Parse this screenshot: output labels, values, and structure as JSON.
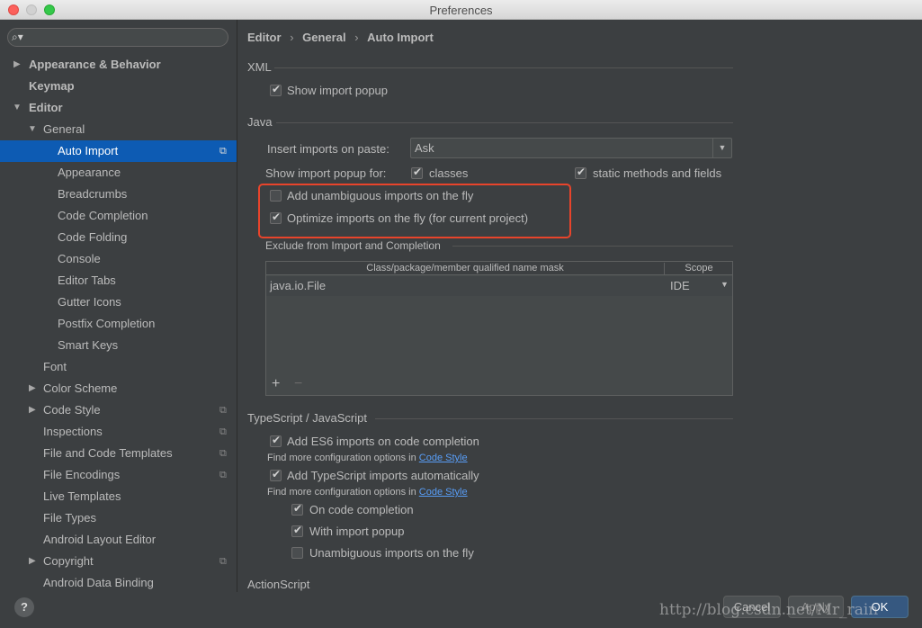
{
  "window": {
    "title": "Preferences"
  },
  "sidebar": {
    "search_placeholder": "",
    "items": [
      {
        "label": "Appearance & Behavior"
      },
      {
        "label": "Keymap"
      },
      {
        "label": "Editor"
      },
      {
        "label": "General"
      },
      {
        "label": "Auto Import"
      },
      {
        "label": "Appearance"
      },
      {
        "label": "Breadcrumbs"
      },
      {
        "label": "Code Completion"
      },
      {
        "label": "Code Folding"
      },
      {
        "label": "Console"
      },
      {
        "label": "Editor Tabs"
      },
      {
        "label": "Gutter Icons"
      },
      {
        "label": "Postfix Completion"
      },
      {
        "label": "Smart Keys"
      },
      {
        "label": "Font"
      },
      {
        "label": "Color Scheme"
      },
      {
        "label": "Code Style"
      },
      {
        "label": "Inspections"
      },
      {
        "label": "File and Code Templates"
      },
      {
        "label": "File Encodings"
      },
      {
        "label": "Live Templates"
      },
      {
        "label": "File Types"
      },
      {
        "label": "Android Layout Editor"
      },
      {
        "label": "Copyright"
      },
      {
        "label": "Android Data Binding"
      }
    ]
  },
  "breadcrumb": {
    "items": [
      "Editor",
      "General",
      "Auto Import"
    ],
    "separator": "›"
  },
  "xml": {
    "section": "XML",
    "show_import_popup": {
      "label": "Show import popup",
      "checked": true
    }
  },
  "java": {
    "section": "Java",
    "insert_imports_label": "Insert imports on paste:",
    "insert_imports_value": "Ask",
    "show_popup_for_label": "Show import popup for:",
    "classes": {
      "label": "classes",
      "checked": true
    },
    "static_methods": {
      "label": "static methods and fields",
      "checked": true
    },
    "add_unambiguous": {
      "label": "Add unambiguous imports on the fly",
      "checked": false
    },
    "optimize_imports": {
      "label": "Optimize imports on the fly (for current project)",
      "checked": true
    },
    "exclude_label": "Exclude from Import and Completion",
    "table": {
      "col_mask": "Class/package/member qualified name mask",
      "col_scope": "Scope",
      "rows": [
        {
          "mask": "java.io.File",
          "scope": "IDE"
        }
      ],
      "add": "+",
      "remove": "−"
    }
  },
  "typescript": {
    "section": "TypeScript / JavaScript",
    "add_es6": {
      "label": "Add ES6 imports on code completion",
      "checked": true
    },
    "find_more_1": "Find more configuration options in",
    "code_style_link_1": "Code Style",
    "add_ts": {
      "label": "Add TypeScript imports automatically",
      "checked": true
    },
    "find_more_2": "Find more configuration options in",
    "code_style_link_2": "Code Style",
    "on_completion": {
      "label": "On code completion",
      "checked": true
    },
    "with_popup": {
      "label": "With import popup",
      "checked": true
    },
    "unambiguous": {
      "label": "Unambiguous imports on the fly",
      "checked": false
    }
  },
  "actionscript": {
    "section": "ActionScript"
  },
  "buttons": {
    "help": "?",
    "cancel": "Cancel",
    "apply": "Apply",
    "ok": "OK"
  },
  "watermark": "http://blog.csdn.net/Mr_rain",
  "colors": {
    "selection": "#0d5bb3",
    "highlight_box": "#e8442b",
    "link": "#589df6"
  }
}
